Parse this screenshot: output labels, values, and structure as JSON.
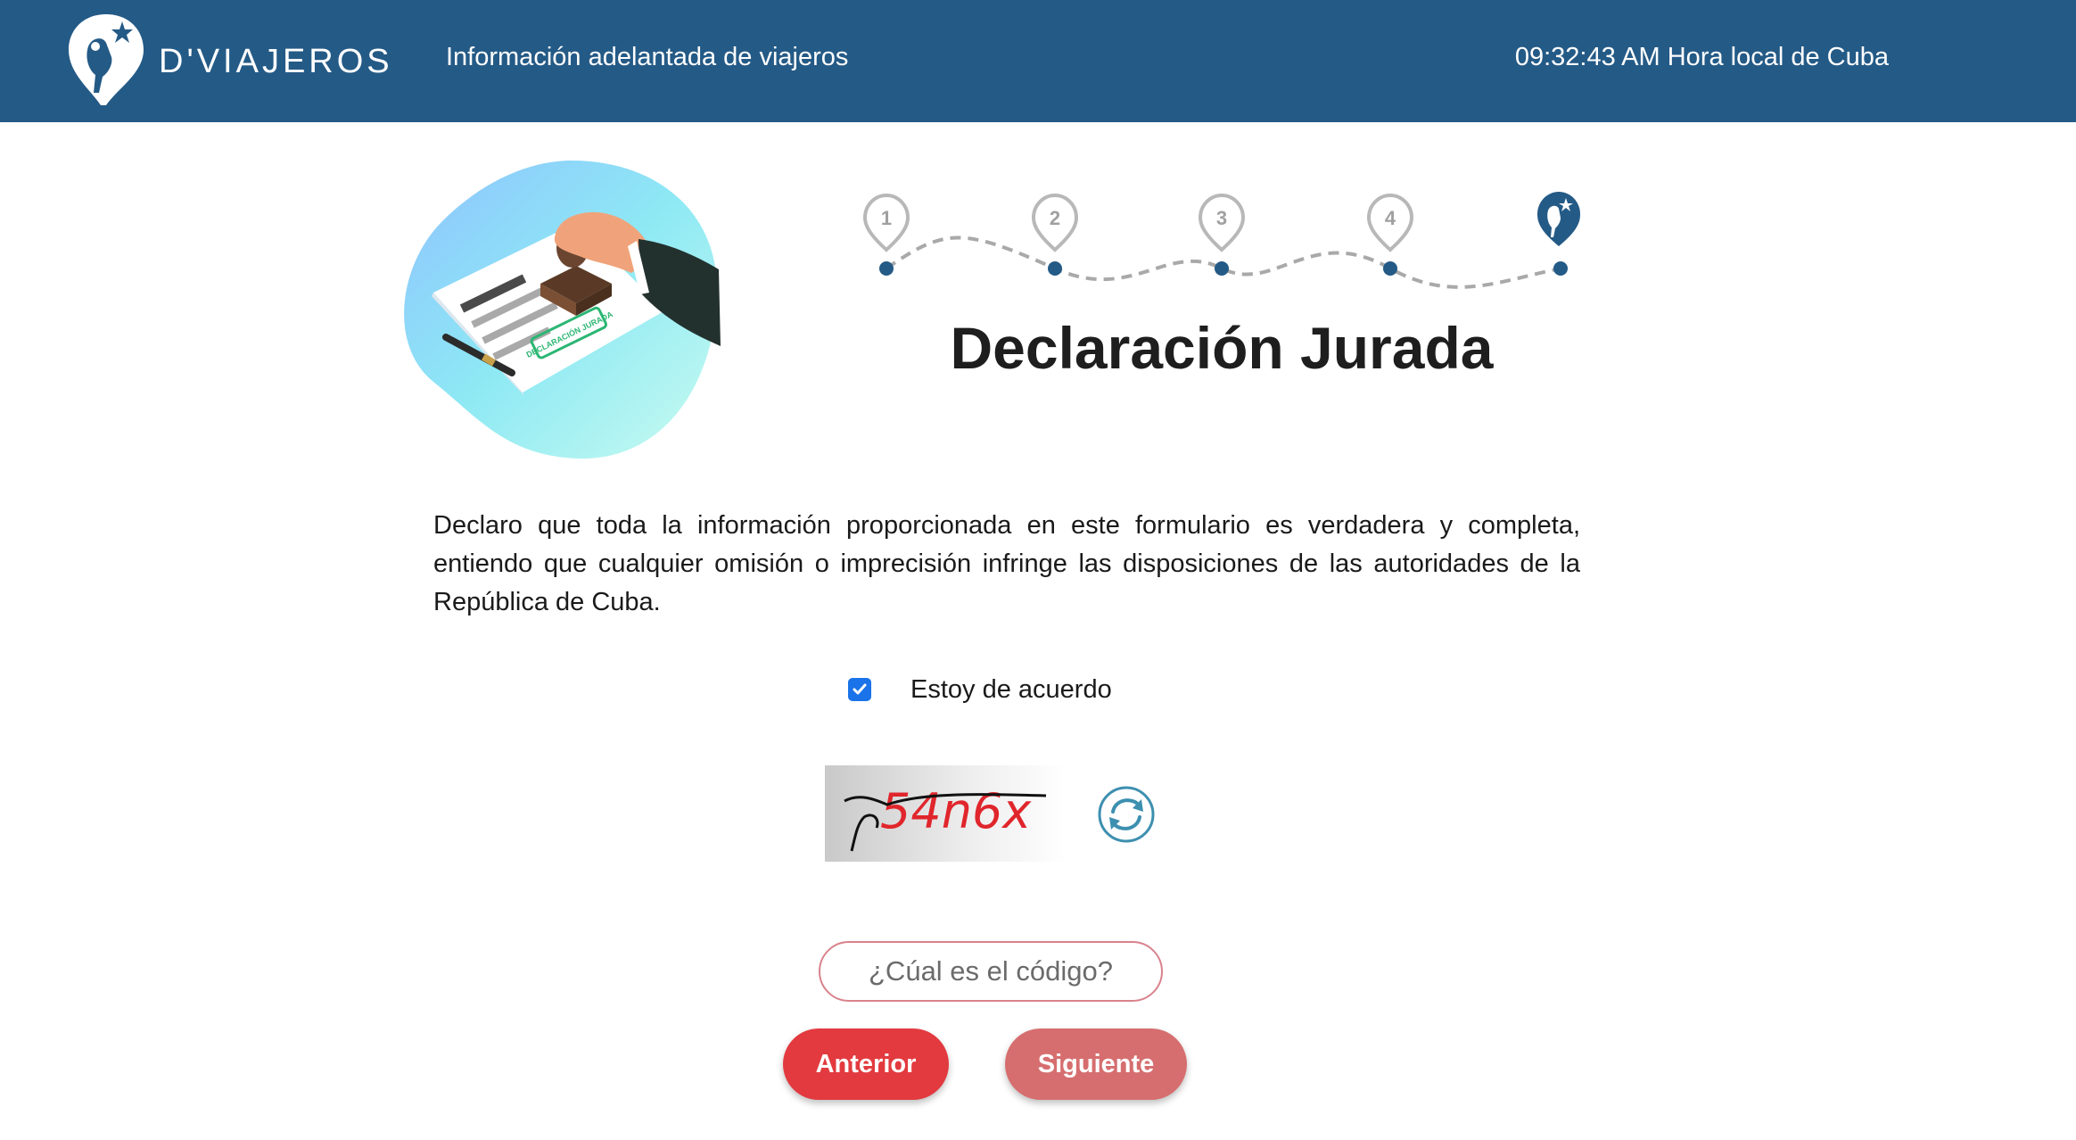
{
  "header": {
    "brand": "D'VIAJEROS",
    "subtitle": "Información adelantada de viajeros",
    "clock": "09:32:43 AM Hora local de Cuba"
  },
  "stepper": {
    "steps": [
      "1",
      "2",
      "3",
      "4"
    ],
    "current_step": 5
  },
  "page": {
    "title": "Declaración Jurada",
    "declaration": "Declaro que toda la información proporcionada en este formulario es verdadera y completa, entiendo que cualquier omisión o imprecisión infringe las disposiciones de las autoridades de la República de Cuba."
  },
  "agree": {
    "label": "Estoy de acuerdo",
    "checked": true
  },
  "captcha": {
    "text": "54n6x",
    "placeholder": "¿Cúal es el código?",
    "value": ""
  },
  "buttons": {
    "previous": "Anterior",
    "next": "Siguiente"
  },
  "illustration": {
    "stamp_text": "DECLARACIÓN JURADA"
  },
  "colors": {
    "header_bg": "#245a86",
    "primary_red": "#e23a3f",
    "disabled_red": "#d66e6f",
    "checkbox_blue": "#1a73e8"
  }
}
